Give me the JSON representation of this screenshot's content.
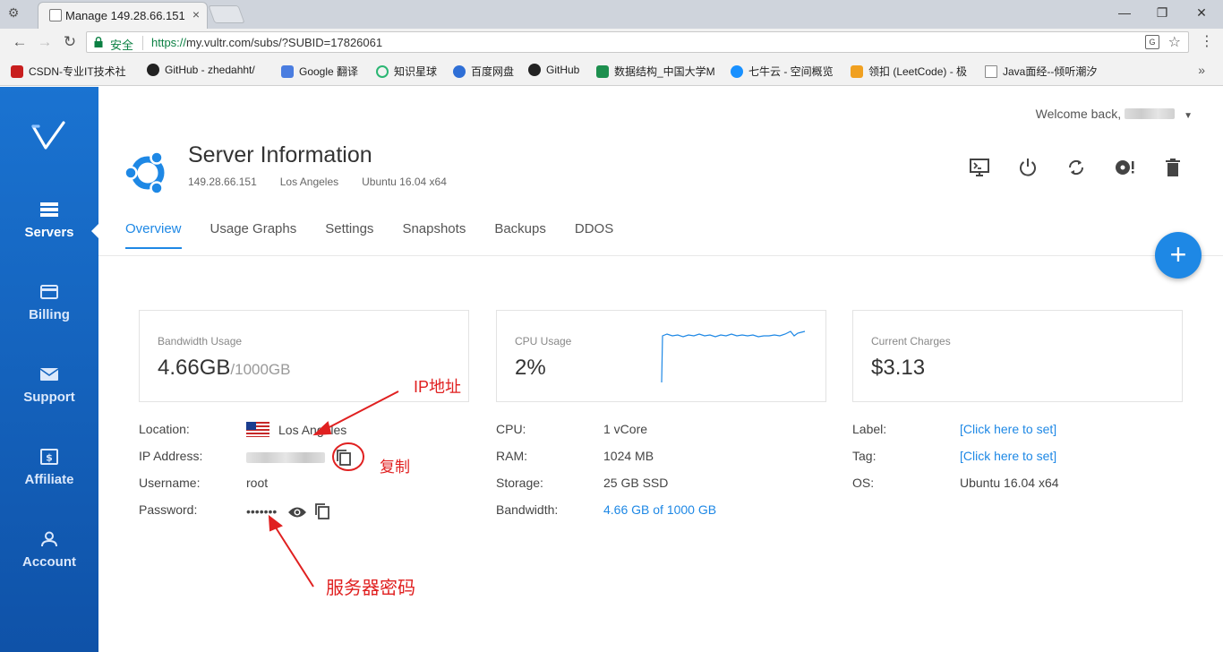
{
  "browser": {
    "tab_title": "Manage 149.28.66.151",
    "tab_close": "×",
    "secure_label": "安全",
    "url_protocol": "https://",
    "url_rest": "my.vultr.com/subs/?SUBID=17826061",
    "bookmarks": [
      {
        "label": "CSDN-专业IT技术社",
        "color": "#c81e1e"
      },
      {
        "label": "GitHub - zhedahht/",
        "color": "#222222"
      },
      {
        "label": "Google 翻译",
        "color": "#4a7de0"
      },
      {
        "label": "知识星球",
        "color": "#2bb673"
      },
      {
        "label": "百度网盘",
        "color": "#2f6fd6"
      },
      {
        "label": "GitHub",
        "color": "#222222"
      },
      {
        "label": "数据结构_中国大学M",
        "color": "#1d8f4e"
      },
      {
        "label": "七牛云 - 空间概览",
        "color": "#1890ff"
      },
      {
        "label": "领扣 (LeetCode) - 极",
        "color": "#f0a020"
      },
      {
        "label": "Java面经--倾听潮汐",
        "color": "#888888"
      }
    ],
    "more_bookmarks": "»"
  },
  "sidebar": {
    "items": [
      {
        "label": "Servers",
        "icon": "servers-icon",
        "active": true
      },
      {
        "label": "Billing",
        "icon": "billing-icon",
        "active": false
      },
      {
        "label": "Support",
        "icon": "support-icon",
        "active": false
      },
      {
        "label": "Affiliate",
        "icon": "affiliate-icon",
        "active": false
      },
      {
        "label": "Account",
        "icon": "account-icon",
        "active": false
      }
    ]
  },
  "header": {
    "welcome": "Welcome back,",
    "title": "Server Information",
    "ip": "149.28.66.151",
    "location": "Los Angeles",
    "os": "Ubuntu 16.04 x64"
  },
  "tabs": [
    "Overview",
    "Usage Graphs",
    "Settings",
    "Snapshots",
    "Backups",
    "DDOS"
  ],
  "cards": {
    "bandwidth": {
      "label": "Bandwidth Usage",
      "value": "4.66GB",
      "limit": "/1000GB"
    },
    "cpu": {
      "label": "CPU Usage",
      "value": "2%"
    },
    "charges": {
      "label": "Current Charges",
      "value": "$3.13"
    }
  },
  "details": {
    "location": {
      "key": "Location:",
      "value": "Los Angeles"
    },
    "ip": {
      "key": "IP Address:"
    },
    "username": {
      "key": "Username:",
      "value": "root"
    },
    "password": {
      "key": "Password:",
      "value": "•••••••"
    },
    "cpu": {
      "key": "CPU:",
      "value": "1 vCore"
    },
    "ram": {
      "key": "RAM:",
      "value": "1024 MB"
    },
    "storage": {
      "key": "Storage:",
      "value": "25 GB SSD"
    },
    "bandwidth": {
      "key": "Bandwidth:",
      "value": "4.66 GB of 1000 GB"
    },
    "label": {
      "key": "Label:",
      "value": "[Click here to set]"
    },
    "tag": {
      "key": "Tag:",
      "value": "[Click here to set]"
    },
    "os": {
      "key": "OS:",
      "value": "Ubuntu 16.04 x64"
    }
  },
  "annotations": {
    "ip": "IP地址",
    "copy": "复制",
    "password": "服务器密码"
  },
  "colors": {
    "accent": "#1e88e5",
    "sidebar": "#1565c0",
    "annotation": "#e02020"
  }
}
